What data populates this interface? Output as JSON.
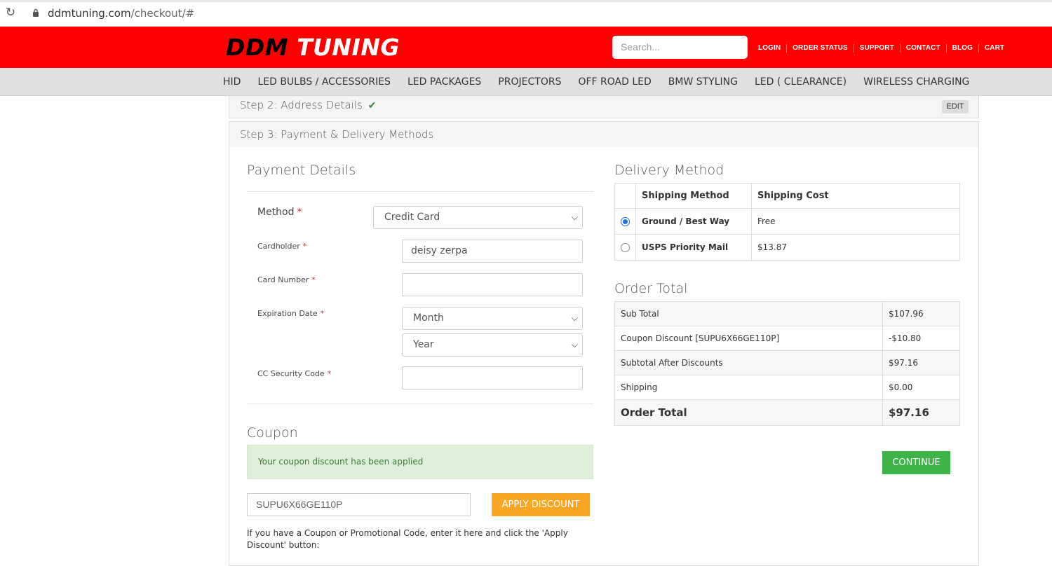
{
  "browser": {
    "url_host": "ddmtuning.com",
    "url_path": "/checkout/#"
  },
  "header": {
    "logo_part1": "DDM",
    "logo_part2": "TUNING",
    "search_placeholder": "Search...",
    "links": [
      "LOGIN",
      "ORDER STATUS",
      "SUPPORT",
      "CONTACT",
      "BLOG",
      "CART"
    ]
  },
  "nav": {
    "items": [
      "HID",
      "LED BULBS / ACCESSORIES",
      "LED PACKAGES",
      "PROJECTORS",
      "OFF ROAD LED",
      "BMW STYLING",
      "LED ( CLEARANCE)",
      "WIRELESS CHARGING"
    ]
  },
  "step2": {
    "title": "Step 2: Address Details",
    "edit_label": "EDIT"
  },
  "step3": {
    "title": "Step 3: Payment & Delivery Methods"
  },
  "payment": {
    "heading": "Payment Details",
    "method_label": "Method",
    "method_value": "Credit Card",
    "cardholder_label": "Cardholder",
    "cardholder_value": "deisy zerpa",
    "card_number_label": "Card Number",
    "card_number_value": "",
    "expiration_label": "Expiration Date",
    "month_value": "Month",
    "year_value": "Year",
    "cvc_label": "CC Security Code",
    "cvc_value": "",
    "required_mark": "*"
  },
  "coupon": {
    "heading": "Coupon",
    "alert": "Your coupon discount has been applied",
    "code_value": "SUPU6X66GE110P",
    "apply_label": "APPLY DISCOUNT",
    "help": "If you have a Coupon or Promotional Code, enter it here and click the 'Apply Discount' button:"
  },
  "delivery": {
    "heading": "Delivery Method",
    "col_method": "Shipping Method",
    "col_cost": "Shipping Cost",
    "options": [
      {
        "method": "Ground / Best Way",
        "cost": "Free",
        "selected": true
      },
      {
        "method": "USPS Priority Mail",
        "cost": "$13.87",
        "selected": false
      }
    ]
  },
  "order_total": {
    "heading": "Order Total",
    "rows": [
      {
        "label": "Sub Total",
        "amount": "$107.96"
      },
      {
        "label": "Coupon Discount [SUPU6X66GE110P]",
        "amount": "-$10.80"
      },
      {
        "label": "Subtotal After Discounts",
        "amount": "$97.16"
      },
      {
        "label": "Shipping",
        "amount": "$0.00"
      }
    ],
    "final_label": "Order Total",
    "final_amount": "$97.16"
  },
  "continue_label": "CONTINUE",
  "colors": {
    "header_red": "#ff0000",
    "apply_orange": "#f8a623",
    "continue_green": "#3eb34a",
    "success_bg": "#dff0d8"
  }
}
